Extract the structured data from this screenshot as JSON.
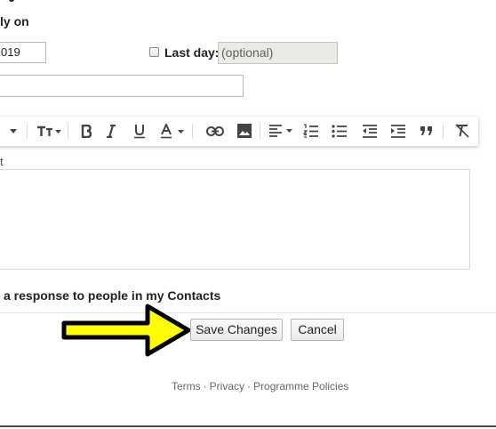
{
  "vacation": {
    "heading": "ly on",
    "first_day_value": "019",
    "last_day_label": "Last day:",
    "last_day_placeholder": "(optional)",
    "last_day_checked": false,
    "subject_value": ""
  },
  "toolbar": {
    "icons": [
      "font-dropdown-chevron-icon",
      "text-size-icon",
      "bold-icon",
      "italic-icon",
      "underline-icon",
      "text-color-icon",
      "link-icon",
      "image-icon",
      "align-icon",
      "numbered-list-icon",
      "bulleted-list-icon",
      "indent-less-icon",
      "indent-more-icon",
      "quote-icon",
      "remove-formatting-icon"
    ]
  },
  "editor": {
    "plain_text_link": "t",
    "body_value": ""
  },
  "contacts_option": {
    "label": "a response to people in my Contacts"
  },
  "actions": {
    "save_label": "Save Changes",
    "cancel_label": "Cancel"
  },
  "footer": {
    "terms": "Terms",
    "privacy": "Privacy",
    "policies": "Programme Policies",
    "separator": "·"
  },
  "colors": {
    "link": "#1155cc",
    "arrow_fill": "#ffff00",
    "arrow_stroke": "#000000",
    "disabled_field": "#ebebe6"
  }
}
